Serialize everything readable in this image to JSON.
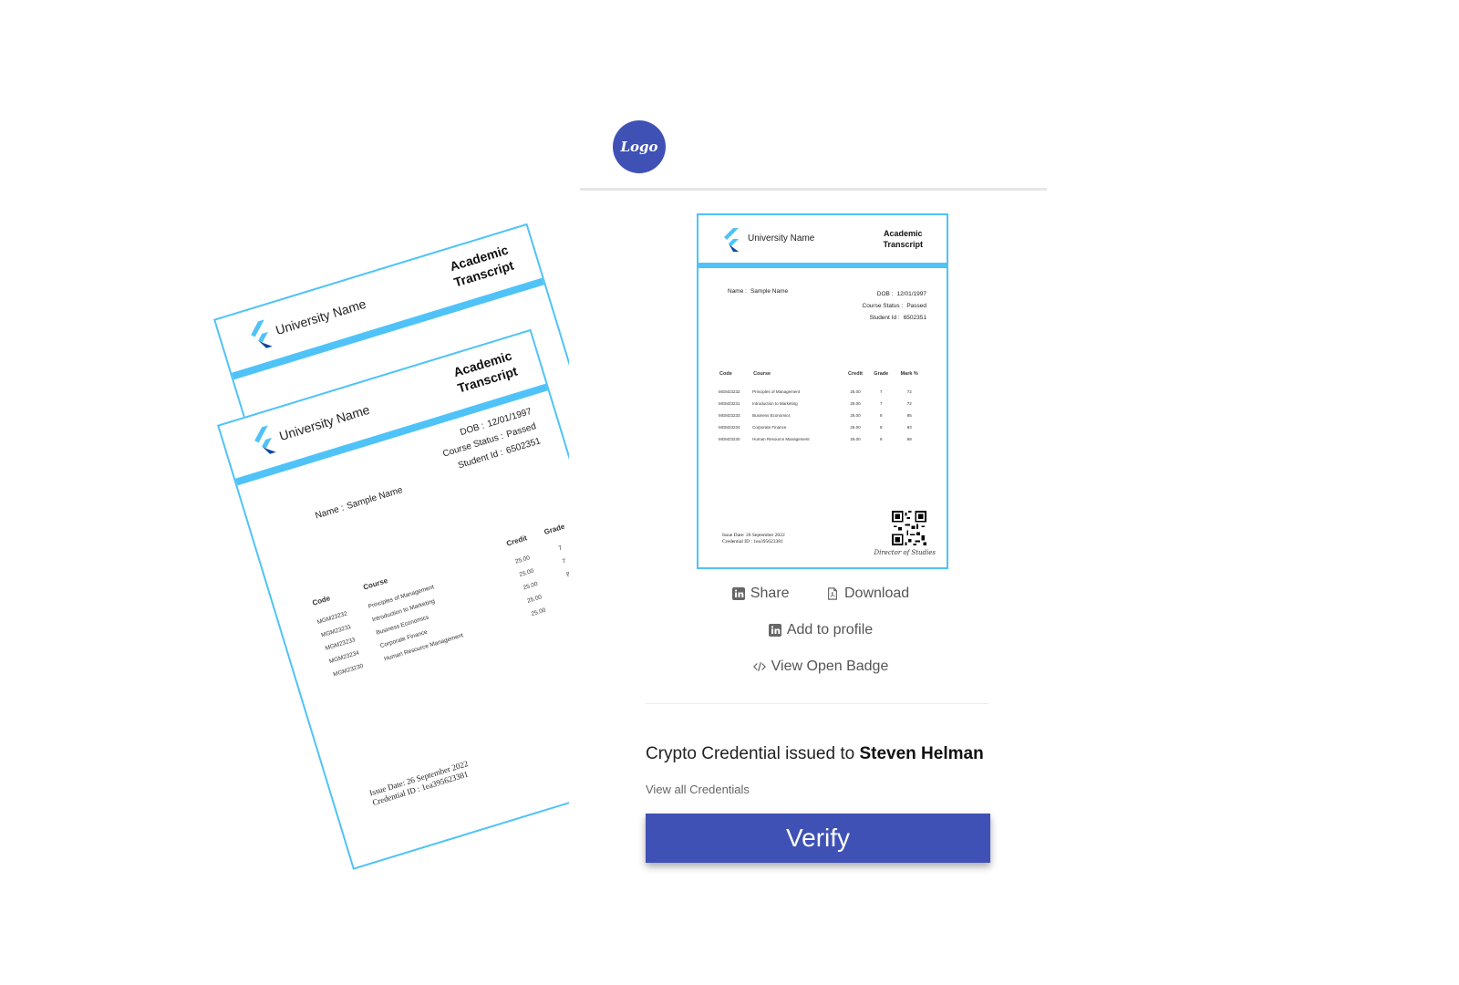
{
  "logo_text": "Logo",
  "colors": {
    "brand": "#3f51b5",
    "doc_accent": "#4fc3f7"
  },
  "transcript": {
    "university_name": "University Name",
    "title_line1": "Academic",
    "title_line2": "Transcript",
    "name_label": "Name :",
    "name_value": "Sample Name",
    "dob_label": "DOB :",
    "dob_value": "12/01/1997",
    "status_label": "Course Status :",
    "status_value": "Passed",
    "student_label": "Student Id :",
    "student_value": "6502351",
    "columns": [
      "Code",
      "Course",
      "Credit",
      "Grade",
      "Mark %"
    ],
    "rows": [
      {
        "code": "MGM23232",
        "course": "Principles of Management",
        "credit": "25.00",
        "grade": "7",
        "mark": "72"
      },
      {
        "code": "MGM23231",
        "course": "Introduction to Marketing",
        "credit": "25.00",
        "grade": "7",
        "mark": "72"
      },
      {
        "code": "MGM23233",
        "course": "Business Economics",
        "credit": "25.00",
        "grade": "8",
        "mark": "85"
      },
      {
        "code": "MGM23234",
        "course": "Corporate Finance",
        "credit": "25.00",
        "grade": "8",
        "mark": "83"
      },
      {
        "code": "MGM23230",
        "course": "Human Resource Management",
        "credit": "25.00",
        "grade": "6",
        "mark": "68"
      }
    ],
    "issue_date": "Issue Date: 26 September 2022",
    "credential_id": "Credential ID : 1ea395623381",
    "signature": "Director of Studies"
  },
  "actions": {
    "share": "Share",
    "download": "Download",
    "add_to_profile": "Add to profile",
    "view_open_badge": "View Open Badge"
  },
  "credential": {
    "issued_prefix": "Crypto Credential issued to",
    "recipient": "Steven Helman",
    "view_all": "View all Credentials",
    "verify": "Verify"
  }
}
